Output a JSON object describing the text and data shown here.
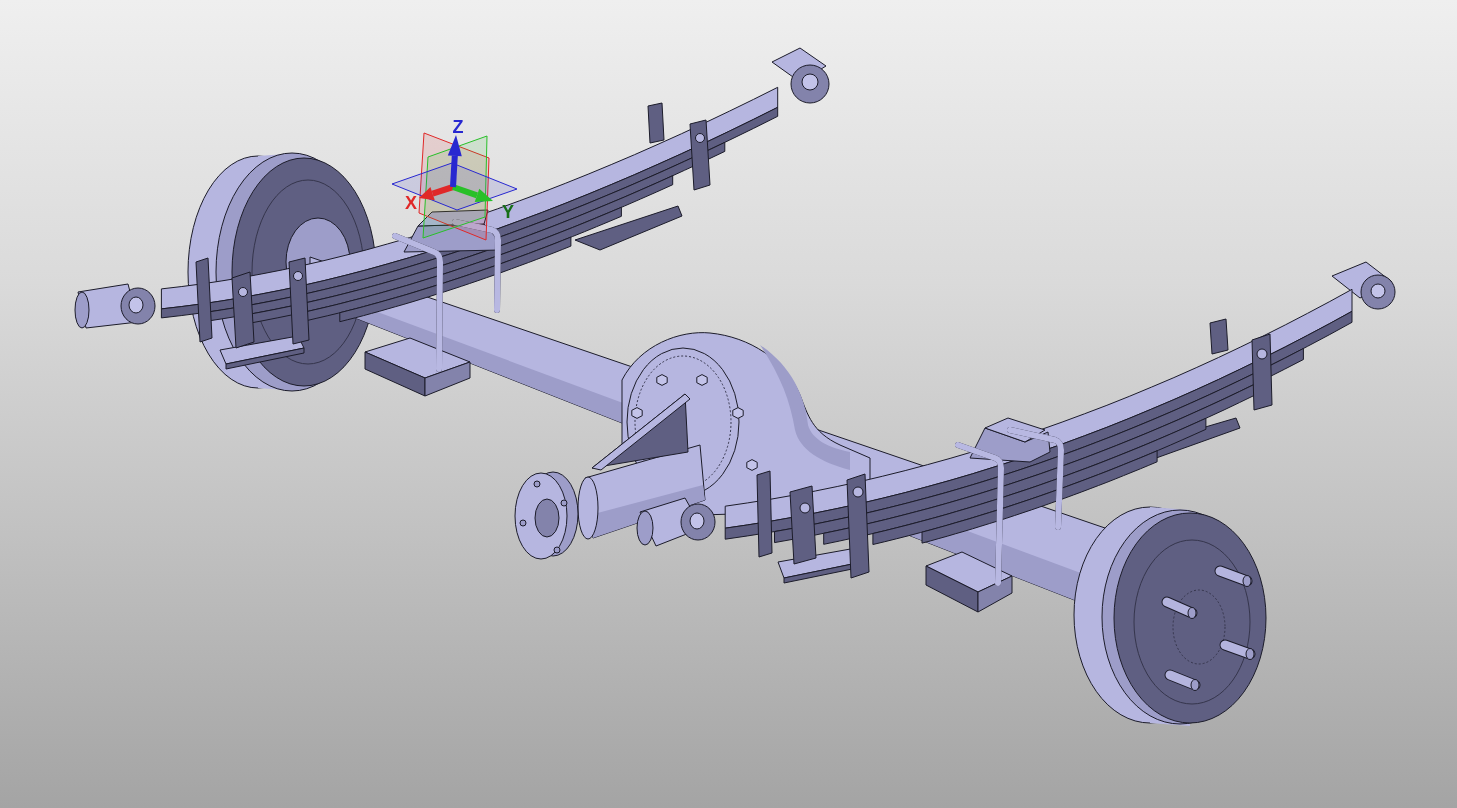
{
  "viewport": {
    "axis_triad": {
      "axes": [
        {
          "label": "X",
          "color": "#e02828"
        },
        {
          "label": "Y",
          "color": "#28c028"
        },
        {
          "label": "Z",
          "color": "#2828d0"
        }
      ]
    }
  }
}
